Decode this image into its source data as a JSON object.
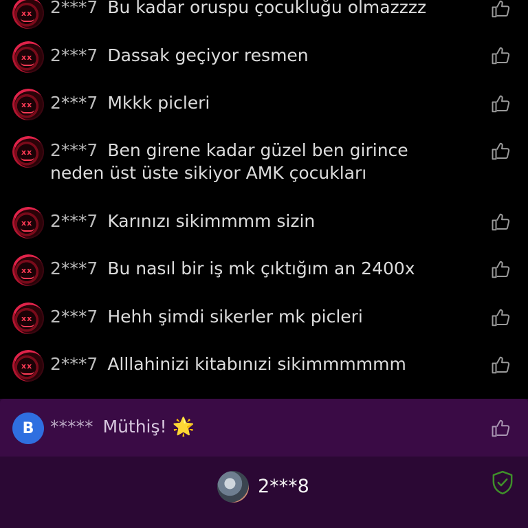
{
  "chat": {
    "messages": [
      {
        "user": "2***7",
        "text": "Bu kadar oruspu çocukluğu olmazzzz"
      },
      {
        "user": "2***7",
        "text": "Dassak geçiyor resmen"
      },
      {
        "user": "2***7",
        "text": "Mkkk picleri"
      },
      {
        "user": "2***7",
        "text": "Ben girene kadar güzel ben girince neden üst üste sikiyor AMK çocukları"
      },
      {
        "user": "2***7",
        "text": "Karınızı sikimmmm sizin"
      },
      {
        "user": "2***7",
        "text": "Bu nasıl bir iş mk çıktığım an 2400x"
      },
      {
        "user": "2***7",
        "text": "Hehh şimdi sikerler mk picleri"
      },
      {
        "user": "2***7",
        "text": "Alllahinizi kitabınızi sikimmmmmm"
      }
    ],
    "avatar_icon": "red-hood-skull-avatar",
    "like_icon": "thumbs-up-outline-icon"
  },
  "highlight_message": {
    "avatar_letter": "B",
    "user": "*****",
    "text": "Müthiş!",
    "emoji": "🌟",
    "avatar_color": "#2f6fe0"
  },
  "footer": {
    "user": "2***8",
    "badge_icon": "verified-shield-check-icon",
    "badge_color": "#3f8f2a"
  },
  "colors": {
    "background": "#000000",
    "panel": "#2e0838",
    "accent_red": "#e0234a"
  }
}
